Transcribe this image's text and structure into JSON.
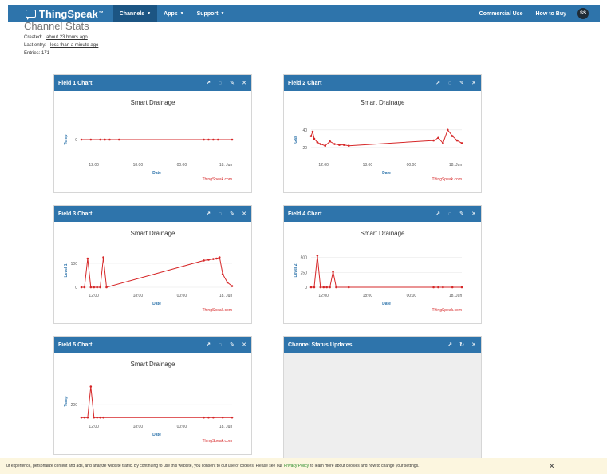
{
  "nav": {
    "brand": "ThingSpeak",
    "tm": "™",
    "channels": "Channels",
    "apps": "Apps",
    "support": "Support",
    "commercial": "Commercial Use",
    "howtobuy": "How to Buy",
    "avatar": "SS"
  },
  "stats": {
    "title": "Channel Stats",
    "created_label": "Created:",
    "created_value": "about 23 hours ago",
    "last_entry_label": "Last entry:",
    "last_entry_value": "less than a minute ago",
    "entries": "Entries: 171"
  },
  "colors": {
    "header": "#2e74ab",
    "series": "#d62728",
    "grid": "#e6e6e6",
    "axis_label": "#2e74ab"
  },
  "icons": [
    "external-link-icon",
    "comment-icon",
    "pencil-icon",
    "close-icon"
  ],
  "panels": [
    {
      "title": "Field 1 Chart"
    },
    {
      "title": "Field 2 Chart"
    },
    {
      "title": "Field 3 Chart"
    },
    {
      "title": "Field 4 Chart"
    },
    {
      "title": "Field 5 Chart"
    },
    {
      "title": "Channel Status Updates"
    }
  ],
  "chart_data": [
    {
      "type": "line",
      "title": "Smart Drainage",
      "xlabel": "Date",
      "ylabel": "Temp",
      "credit": "ThingSpeak.com",
      "x_ticks": [
        "12:00",
        "18:00",
        "00:00",
        "18. Jun"
      ],
      "xlim": [
        "11:00",
        "19:00"
      ],
      "y_ticks": [
        0
      ],
      "ylim": [
        -1,
        1
      ],
      "series": [
        {
          "x": [
            "11:00",
            "11:30",
            "12:00",
            "12:15",
            "12:30",
            "13:00",
            "17:30",
            "17:45",
            "18:00",
            "18:15",
            "19:00"
          ],
          "y": [
            0,
            0,
            0,
            0,
            0,
            0,
            0,
            0,
            0,
            0,
            0
          ]
        }
      ]
    },
    {
      "type": "line",
      "title": "Smart Drainage",
      "xlabel": "Date",
      "ylabel": "Gas",
      "credit": "ThingSpeak.com",
      "x_ticks": [
        "12:00",
        "18:00",
        "00:00",
        "18. Jun"
      ],
      "xlim": [
        "11:00",
        "19:00"
      ],
      "y_ticks": [
        20,
        40
      ],
      "ylim": [
        10,
        48
      ],
      "series": [
        {
          "x": [
            "11:00",
            "11:05",
            "11:10",
            "11:20",
            "11:30",
            "11:45",
            "12:00",
            "12:15",
            "12:30",
            "12:45",
            "13:00",
            "17:30",
            "17:45",
            "18:00",
            "18:15",
            "18:30",
            "18:45",
            "19:00"
          ],
          "y": [
            33,
            38,
            30,
            26,
            24,
            22,
            27,
            24,
            23,
            23,
            22,
            28,
            31,
            25,
            40,
            33,
            28,
            25
          ]
        }
      ]
    },
    {
      "type": "line",
      "title": "Smart Drainage",
      "xlabel": "Date",
      "ylabel": "Level 1",
      "credit": "ThingSpeak.com",
      "x_ticks": [
        "12:00",
        "18:00",
        "00:00",
        "18. Jun"
      ],
      "xlim": [
        "11:00",
        "19:00"
      ],
      "y_ticks": [
        0,
        100
      ],
      "ylim": [
        0,
        140
      ],
      "series": [
        {
          "x": [
            "11:00",
            "11:10",
            "11:20",
            "11:30",
            "11:40",
            "11:50",
            "12:00",
            "12:10",
            "12:20",
            "17:30",
            "17:45",
            "18:00",
            "18:10",
            "18:20",
            "18:30",
            "18:45",
            "19:00"
          ],
          "y": [
            0,
            0,
            120,
            0,
            0,
            0,
            0,
            125,
            0,
            112,
            115,
            118,
            120,
            125,
            55,
            20,
            5
          ]
        }
      ]
    },
    {
      "type": "line",
      "title": "Smart Drainage",
      "xlabel": "Date",
      "ylabel": "Level 2",
      "credit": "ThingSpeak.com",
      "x_ticks": [
        "12:00",
        "18:00",
        "00:00",
        "18. Jun"
      ],
      "xlim": [
        "11:00",
        "19:00"
      ],
      "y_ticks": [
        0,
        250,
        500
      ],
      "ylim": [
        0,
        560
      ],
      "series": [
        {
          "x": [
            "11:00",
            "11:10",
            "11:20",
            "11:30",
            "11:40",
            "11:50",
            "12:00",
            "12:10",
            "12:20",
            "13:00",
            "17:30",
            "17:45",
            "18:00",
            "18:30",
            "19:00"
          ],
          "y": [
            0,
            0,
            530,
            0,
            0,
            0,
            0,
            260,
            0,
            0,
            0,
            0,
            0,
            0,
            0
          ]
        }
      ]
    },
    {
      "type": "line",
      "title": "Smart Drainage",
      "xlabel": "Date",
      "ylabel": "Temp",
      "credit": "ThingSpeak.com",
      "x_ticks": [
        "12:00",
        "18:00",
        "00:00",
        "18. Jun"
      ],
      "xlim": [
        "11:00",
        "19:00"
      ],
      "y_ticks": [
        200
      ],
      "ylim": [
        0,
        500
      ],
      "series": [
        {
          "x": [
            "11:00",
            "11:10",
            "11:20",
            "11:30",
            "11:40",
            "11:50",
            "12:00",
            "12:10",
            "17:30",
            "17:45",
            "18:00",
            "18:30",
            "19:00"
          ],
          "y": [
            10,
            10,
            10,
            470,
            10,
            10,
            10,
            10,
            10,
            10,
            10,
            10,
            10
          ]
        }
      ]
    }
  ],
  "cookie": {
    "text1": "ur experience, personalize content and ads, and analyze website traffic. By continuing to use this website, you consent to our use of cookies. Please see our",
    "link": "Privacy Policy",
    "text2": "to learn more about cookies and how to change your settings.",
    "close": "✕"
  }
}
